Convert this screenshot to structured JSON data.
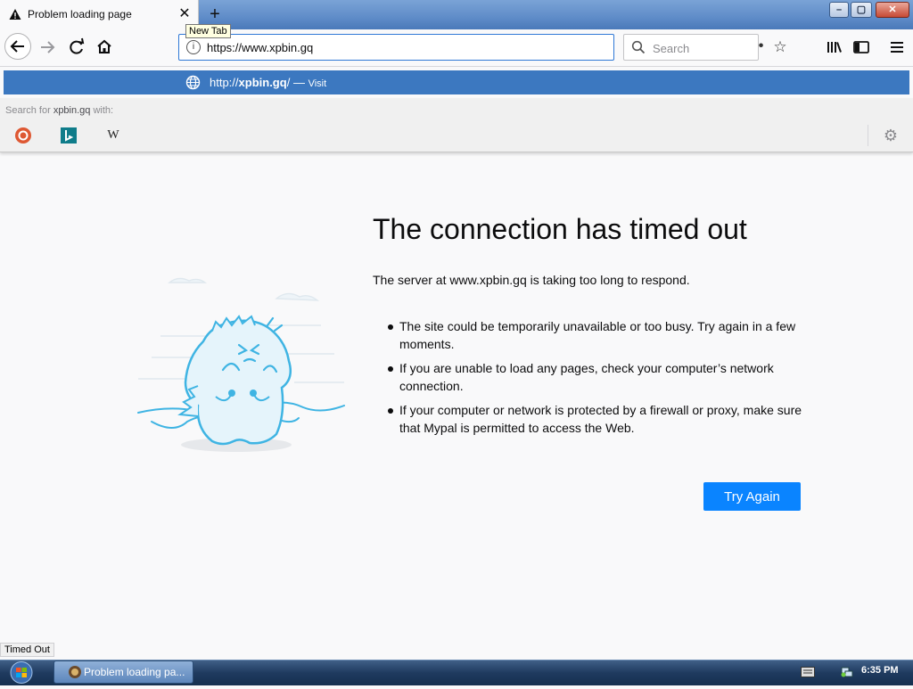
{
  "tab": {
    "title": "Problem loading page",
    "close_glyph": "✕",
    "warning_icon": "warning-icon"
  },
  "tooltip": "New Tab",
  "window_controls": {
    "minimize": "–",
    "maximize": "▢",
    "close": "✕"
  },
  "nav": {
    "url": "https://www.xpbin.gq",
    "search_placeholder": "Search",
    "page_actions": "•••"
  },
  "popup": {
    "url_prefix": "http://",
    "url_bold": "xpbin.gq",
    "url_suffix": "/",
    "separator": "—",
    "visit_label": "Visit",
    "search_for_prefix": "Search for",
    "search_for_term": "xpbin.gq",
    "search_for_suffix": "with:",
    "engines": [
      "duckduckgo-icon",
      "bing-icon",
      "wikipedia-icon"
    ],
    "wiki_glyph": "W"
  },
  "error": {
    "title": "The connection has timed out",
    "description": "The server at www.xpbin.gq is taking too long to respond.",
    "bullets": [
      "The site could be temporarily unavailable or too busy. Try again in a few moments.",
      "If you are unable to load any pages, check your computer’s network connection.",
      "If your computer or network is protected by a firewall or proxy, make sure that Mypal is permitted to access the Web."
    ],
    "button_label": "Try Again"
  },
  "status_text": "Timed Out",
  "taskbar": {
    "task_label": "Problem loading pa...",
    "clock": "6:35 PM"
  },
  "colors": {
    "accent": "#0a84ff",
    "popup_bg": "#3c78c0",
    "illustration": "#3fb4e3"
  }
}
